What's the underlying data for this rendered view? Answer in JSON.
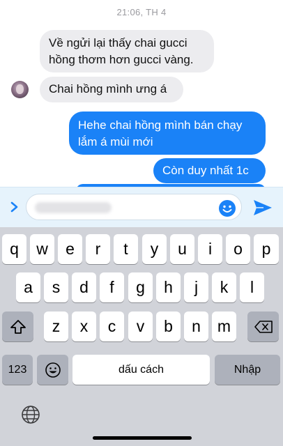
{
  "timestamp": "21:06, TH 4",
  "messages": [
    {
      "text": "Về ngửi lại thấy chai gucci hồng thơm hơn gucci vàng."
    },
    {
      "text": "Chai hồng mình ưng á"
    },
    {
      "text": "Hehe chai hồng mình bán chạy lắm á mùi mới"
    },
    {
      "text": "Còn duy nhất 1c"
    }
  ],
  "keyboard": {
    "row1": [
      "q",
      "w",
      "e",
      "r",
      "t",
      "y",
      "u",
      "i",
      "o",
      "p"
    ],
    "row2": [
      "a",
      "s",
      "d",
      "f",
      "g",
      "h",
      "j",
      "k",
      "l"
    ],
    "row3": [
      "z",
      "x",
      "c",
      "v",
      "b",
      "n",
      "m"
    ],
    "numbers_label": "123",
    "space_label": "dấu cách",
    "return_label": "Nhập"
  },
  "colors": {
    "outgoing_bubble": "#1a82f7",
    "incoming_bubble": "#ececef",
    "composer_bg": "#e6f3fc",
    "keyboard_bg": "#d1d3d9"
  },
  "icons": {
    "expand": "chevron-right-icon",
    "emoji": "smiley-icon",
    "send": "paper-plane-icon",
    "shift": "shift-arrow-icon",
    "delete": "backspace-icon",
    "emoji_key": "emoji-face-icon",
    "language": "globe-icon"
  }
}
